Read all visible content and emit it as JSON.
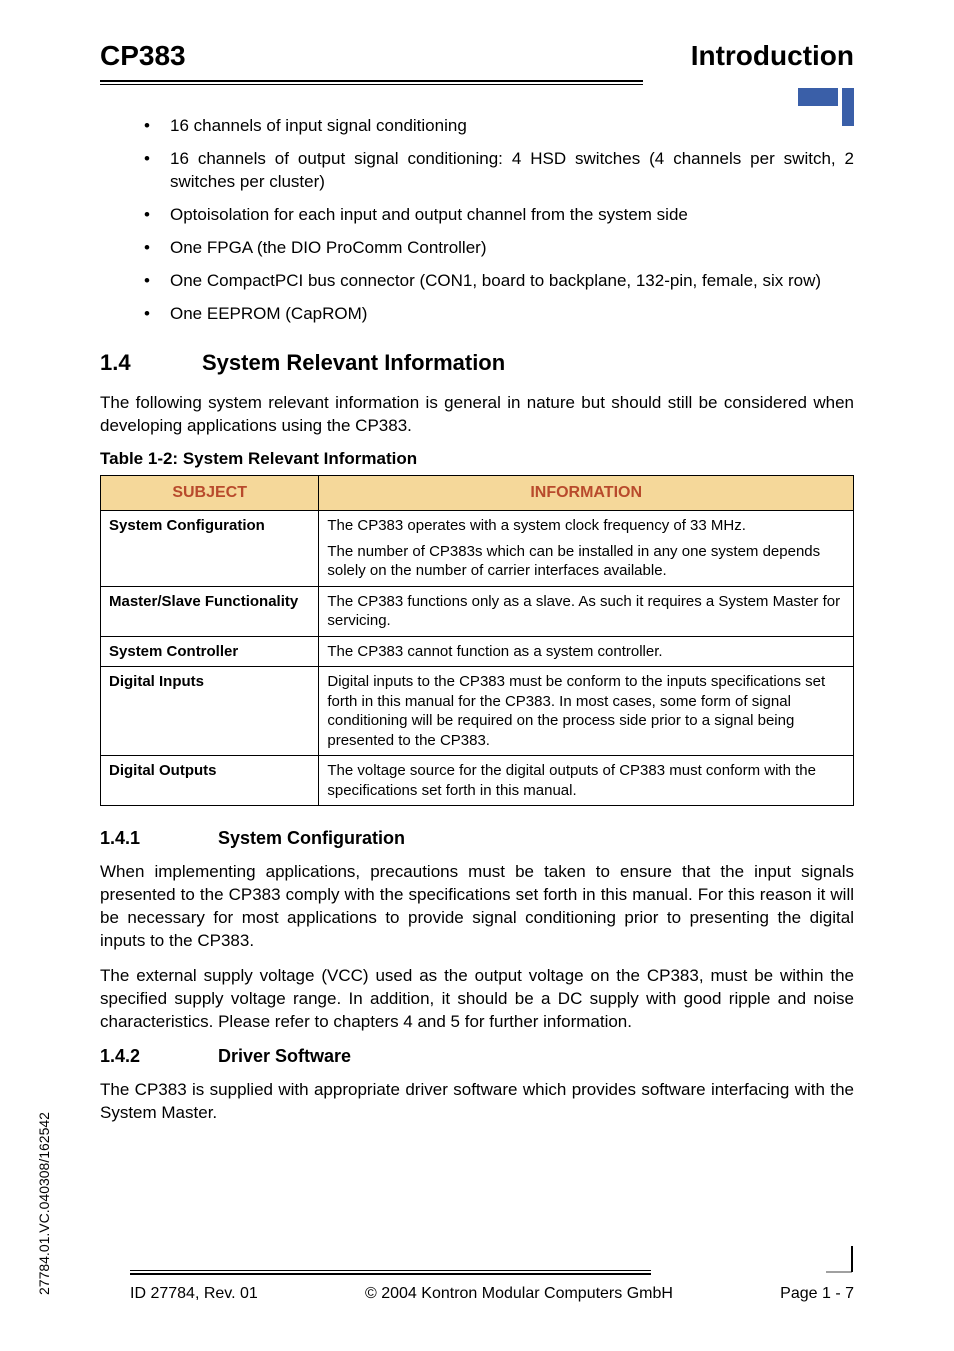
{
  "header": {
    "left": "CP383",
    "right": "Introduction"
  },
  "bullets": [
    "16 channels of input signal conditioning",
    "16 channels of output signal conditioning: 4 HSD switches (4 channels per switch, 2 switches per cluster)",
    "Optoisolation for each input and output channel from the system side",
    "One FPGA (the DIO ProComm Controller)",
    "One CompactPCI bus connector (CON1, board to backplane, 132-pin, female, six row)",
    "One EEPROM (CapROM)"
  ],
  "section_1_4": {
    "num": "1.4",
    "title": "System Relevant Information",
    "intro": "The following system relevant information is general in nature but should still be considered when developing applications using the CP383."
  },
  "table": {
    "caption": "Table 1-2:  System Relevant Information",
    "headers": {
      "subject": "SUBJECT",
      "info": "INFORMATION"
    },
    "rows": [
      {
        "subject": "System Configuration",
        "info": [
          "The CP383 operates with a system clock frequency of 33 MHz.",
          "The number of CP383s which can be installed in any one system depends solely on the number of carrier interfaces available."
        ]
      },
      {
        "subject": "Master/Slave Functionality",
        "info": [
          "The CP383 functions only as a slave. As such it requires a System Master for servicing."
        ]
      },
      {
        "subject": "System Controller",
        "info": [
          "The CP383 cannot function as a system controller."
        ]
      },
      {
        "subject": "Digital Inputs",
        "info": [
          "Digital inputs to the CP383 must be conform to the inputs specifications set forth in this manual for the CP383. In most cases, some form of signal conditioning will be required on the process side prior to a signal being presented to the CP383."
        ]
      },
      {
        "subject": "Digital Outputs",
        "info": [
          "The voltage source for the digital outputs of CP383 must conform with the specifications set forth in this manual."
        ]
      }
    ]
  },
  "section_1_4_1": {
    "num": "1.4.1",
    "title": "System Configuration",
    "p1": "When implementing applications, precautions must be taken to ensure that the input signals presented to the CP383 comply with the specifications set forth in this manual. For this reason it will be necessary for most applications to provide signal conditioning prior to presenting the digital inputs to the CP383.",
    "p2": "The external supply voltage (VCC) used as the output voltage on the CP383, must be within the specified supply voltage range. In addition, it should be a DC supply with good ripple and noise characteristics. Please refer to chapters 4 and 5 for further information."
  },
  "section_1_4_2": {
    "num": "1.4.2",
    "title": "Driver Software",
    "p1": "The CP383 is supplied with appropriate driver software which provides software interfacing with the System Master."
  },
  "side_code": "27784.01.VC.040308/162542",
  "footer": {
    "left": "ID 27784, Rev. 01",
    "center": "© 2004 Kontron Modular Computers GmbH",
    "right": "Page 1 - 7"
  }
}
